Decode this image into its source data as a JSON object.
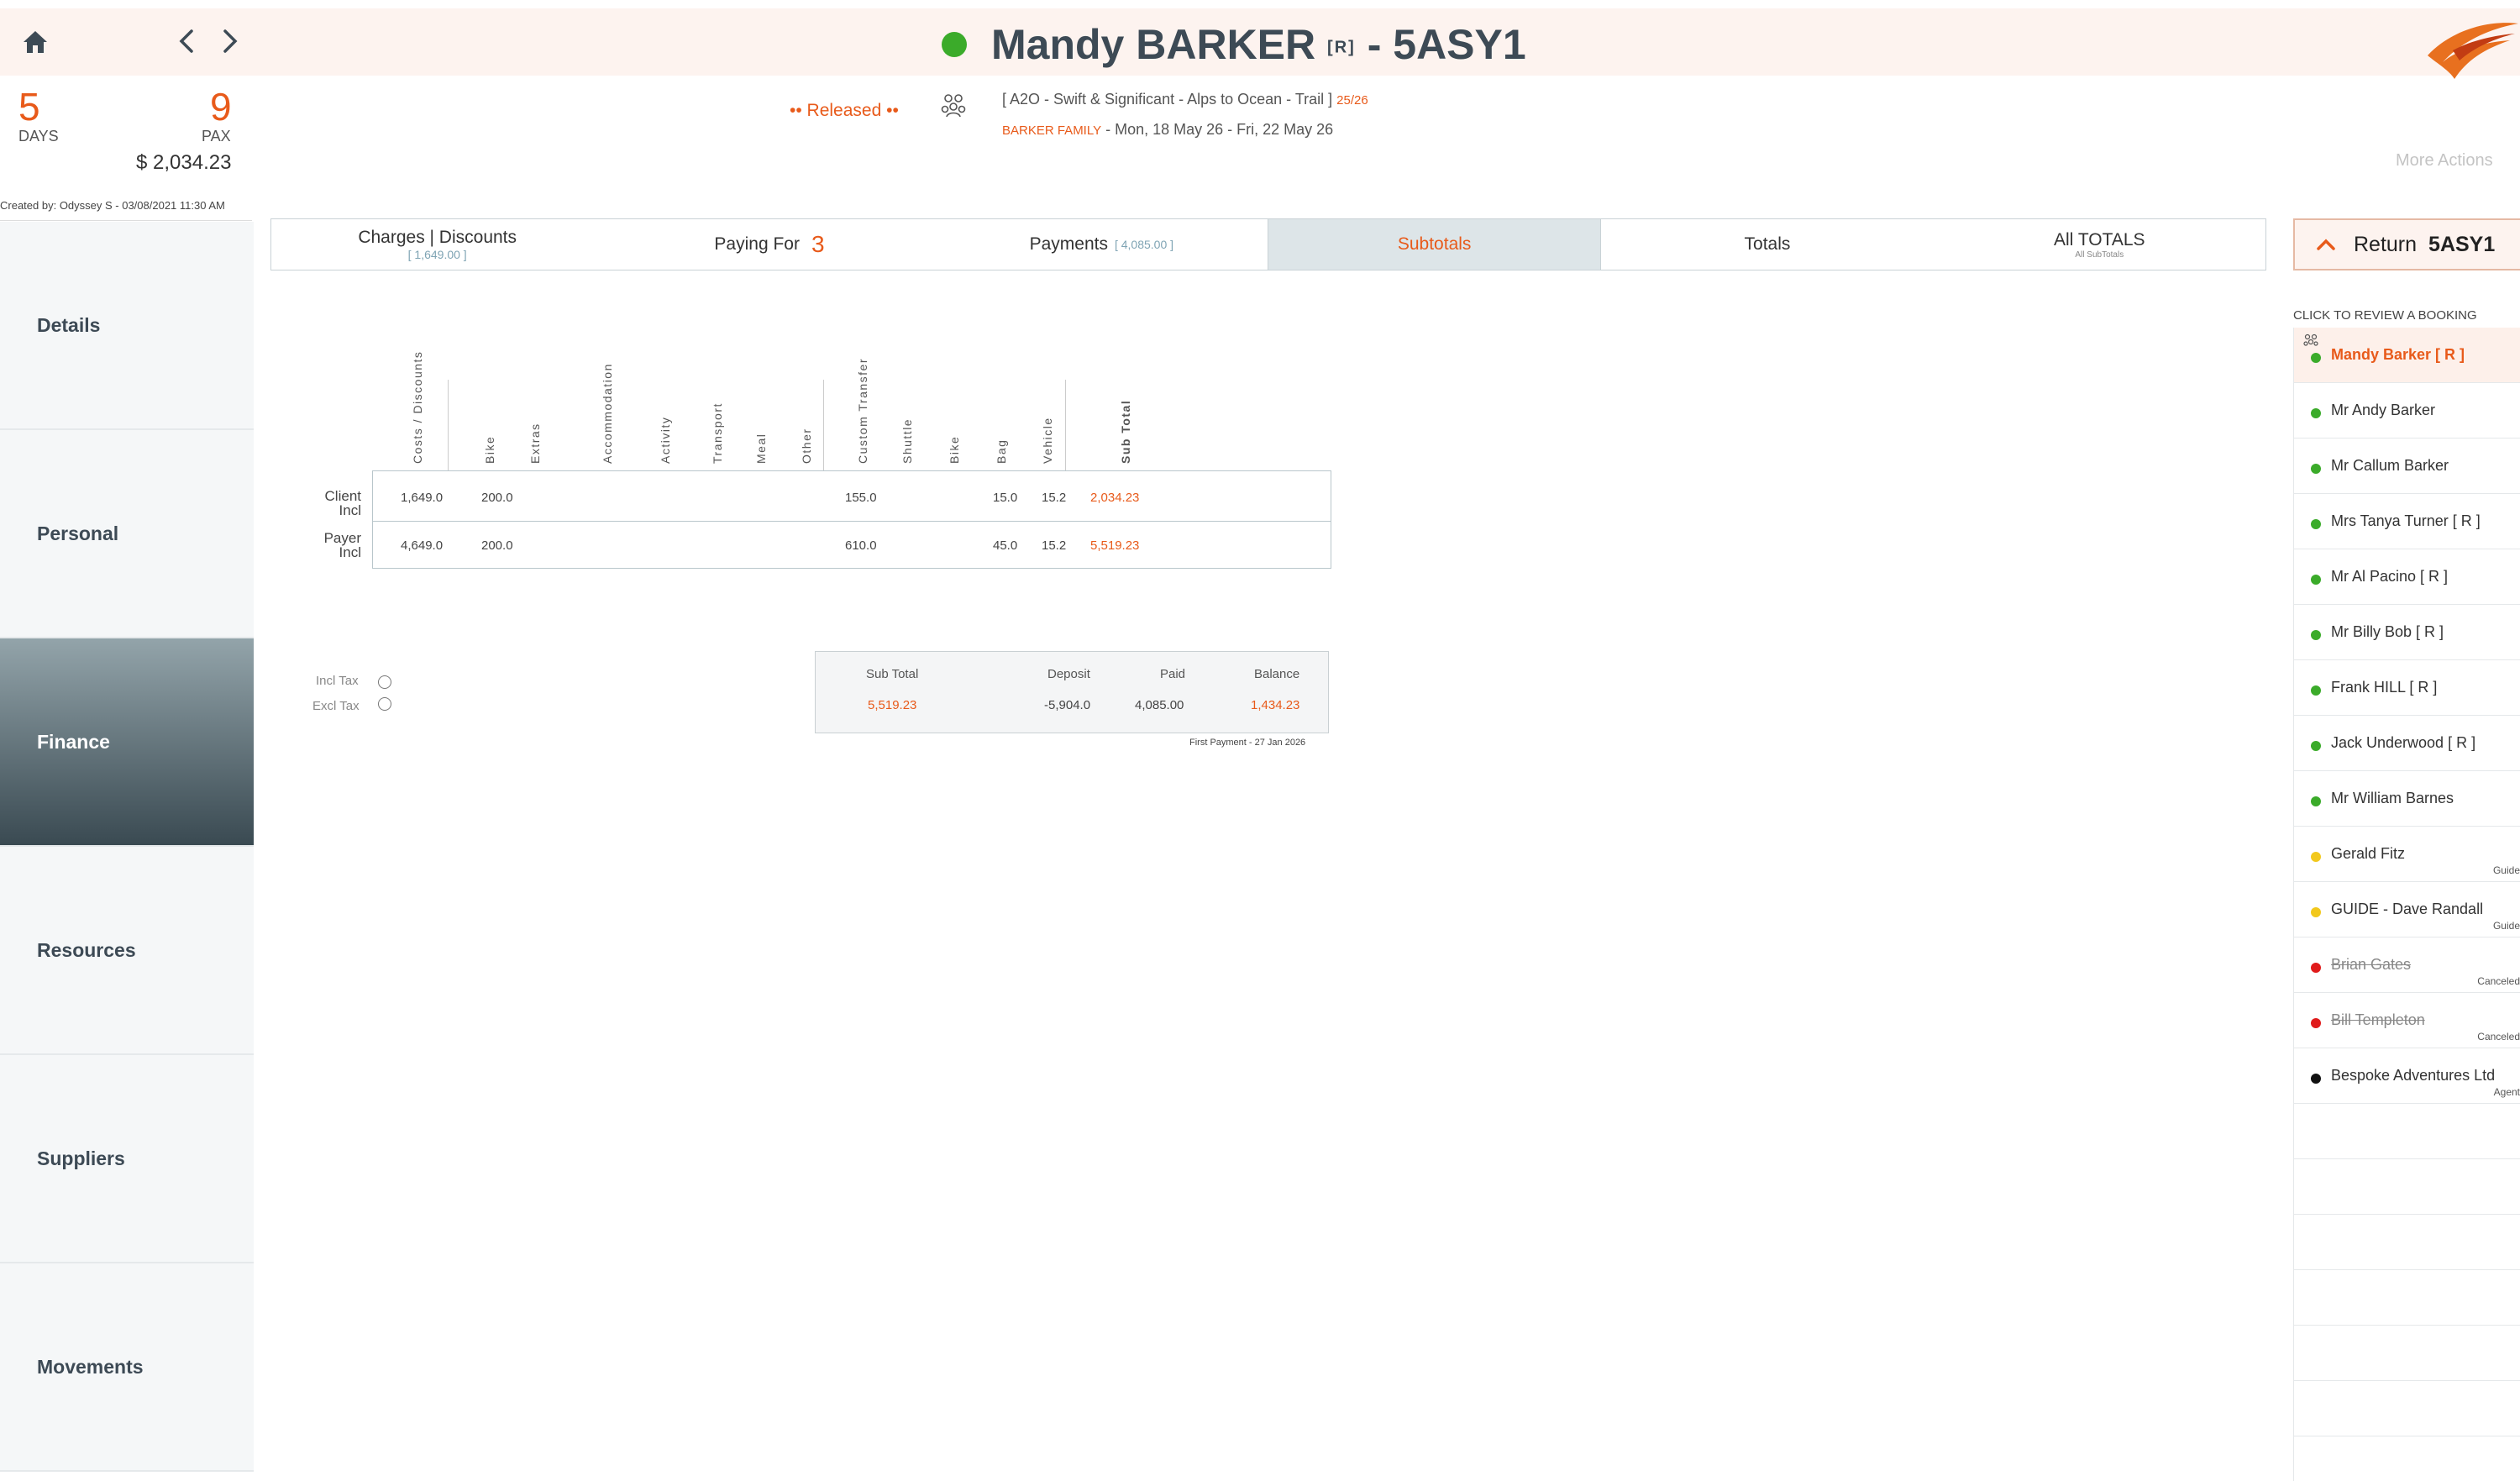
{
  "header": {
    "title_name": "Mandy BARKER",
    "title_tag": "[R]",
    "title_sep": " - ",
    "title_code": "5ASY1",
    "status_color": "#3bab2a"
  },
  "info": {
    "days": "5",
    "days_label": "DAYS",
    "pax": "9",
    "pax_label": "PAX",
    "amount": "$ 2,034.23",
    "created_by": "Created by: Odyssey S - 03/08/2021 11:30 AM"
  },
  "sidebar": {
    "items": [
      "Details",
      "Personal",
      "Finance",
      "Resources",
      "Suppliers",
      "Movements"
    ],
    "active": "Finance"
  },
  "booking": {
    "status": "•• Released ••",
    "trip": "[ A2O - Swift & Significant - Alps to Ocean - Trail ]",
    "season": "25/26",
    "family": "BARKER FAMILY",
    "dates": " - Mon, 18 May 26 - Fri, 22 May 26",
    "more_actions": "More Actions"
  },
  "tabs": {
    "charges_label": "Charges | Discounts",
    "charges_sub": "[ 1,649.00 ]",
    "paying_label": "Paying For",
    "paying_count": "3",
    "payments_label": "Payments",
    "payments_sub": "[ 4,085.00 ]",
    "subtotals_label": "Subtotals",
    "totals_label": "Totals",
    "alltotals_label": "All TOTALS",
    "alltotals_sub": "All SubTotals"
  },
  "return_btn": {
    "label": "Return",
    "code": "5ASY1"
  },
  "subtotals": {
    "columns": [
      "Costs / Discounts",
      "Bike",
      "Extras",
      "Accommodation",
      "Activity",
      "Transport",
      "Meal",
      "Other",
      "Custom Transfer",
      "Shuttle",
      "Bike",
      "Bag",
      "Vehicle",
      "Sub Total"
    ],
    "rows": [
      {
        "label1": "Client",
        "label2": "Incl",
        "costs": "1,649.0",
        "bike": "200.0",
        "custom": "155.0",
        "bag": "15.0",
        "vehicle": "15.2",
        "subtotal": "2,034.23"
      },
      {
        "label1": "Payer",
        "label2": "Incl",
        "costs": "4,649.0",
        "bike": "200.0",
        "custom": "610.0",
        "bag": "45.0",
        "vehicle": "15.2",
        "subtotal": "5,519.23"
      }
    ]
  },
  "tax": {
    "incl": "Incl Tax",
    "excl": "Excl Tax"
  },
  "summary": {
    "h_subtotal": "Sub Total",
    "h_deposit": "Deposit",
    "h_paid": "Paid",
    "h_balance": "Balance",
    "subtotal": "5,519.23",
    "deposit": "-5,904.0",
    "paid": "4,085.00",
    "balance": "1,434.23",
    "first_payment": "First Payment - 27 Jan 2026"
  },
  "booking_list": {
    "heading": "CLICK TO REVIEW A BOOKING",
    "items": [
      {
        "name": "Mandy Barker  [ R ]",
        "color": "#3bab2a",
        "role": "",
        "strike": false
      },
      {
        "name": "Mr Andy Barker",
        "color": "#3bab2a",
        "role": "",
        "strike": false
      },
      {
        "name": "Mr Callum Barker",
        "color": "#3bab2a",
        "role": "",
        "strike": false
      },
      {
        "name": "Mrs Tanya Turner  [ R ]",
        "color": "#3bab2a",
        "role": "",
        "strike": false
      },
      {
        "name": "Mr Al Pacino  [ R ]",
        "color": "#3bab2a",
        "role": "",
        "strike": false
      },
      {
        "name": "Mr Billy Bob  [ R ]",
        "color": "#3bab2a",
        "role": "",
        "strike": false
      },
      {
        "name": "Frank HILL  [ R ]",
        "color": "#3bab2a",
        "role": "",
        "strike": false
      },
      {
        "name": "Jack Underwood  [ R ]",
        "color": "#3bab2a",
        "role": "",
        "strike": false
      },
      {
        "name": "Mr William Barnes",
        "color": "#3bab2a",
        "role": "",
        "strike": false
      },
      {
        "name": "Gerald Fitz",
        "color": "#f2c81c",
        "role": "Guide",
        "strike": false
      },
      {
        "name": "GUIDE - Dave Randall",
        "color": "#f2c81c",
        "role": "Guide",
        "strike": false
      },
      {
        "name": "Brian Gates",
        "color": "#e01b1b",
        "role": "Canceled",
        "strike": true
      },
      {
        "name": "Bill Templeton",
        "color": "#e01b1b",
        "role": "Canceled",
        "strike": true
      },
      {
        "name": "Bespoke Adventures Ltd",
        "color": "#111111",
        "role": "Agent",
        "strike": false
      }
    ]
  },
  "colors": {
    "accent": "#e85a1a",
    "header_bg": "#fdf3ef",
    "sidebar_active_top": "#93a4aa",
    "sidebar_active_bottom": "#3a4a52"
  }
}
